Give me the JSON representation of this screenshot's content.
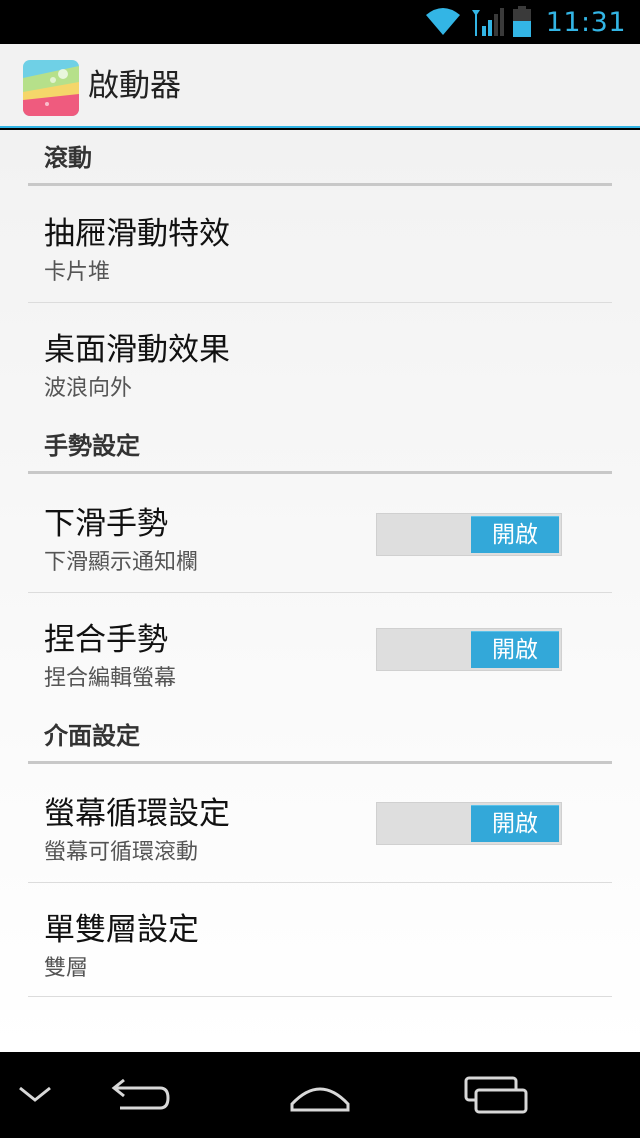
{
  "status_bar": {
    "time": "11:31",
    "icons": [
      "wifi-icon",
      "signal-icon",
      "battery-icon"
    ],
    "accent": "#33b5e5"
  },
  "app": {
    "title": "啟動器",
    "icon": "launcher-app-icon"
  },
  "sections": {
    "scroll": {
      "title": "滾動",
      "drawer_effect": {
        "title": "抽屜滑動特效",
        "summary": "卡片堆"
      },
      "desktop_effect": {
        "title": "桌面滑動效果",
        "summary": "波浪向外"
      }
    },
    "gesture": {
      "title": "手勢設定",
      "swipe_down": {
        "title": "下滑手勢",
        "summary": "下滑顯示通知欄",
        "toggle": "開啟"
      },
      "pinch": {
        "title": "捏合手勢",
        "summary": "捏合編輯螢幕",
        "toggle": "開啟"
      }
    },
    "interface": {
      "title": "介面設定",
      "loop": {
        "title": "螢幕循環設定",
        "summary": "螢幕可循環滾動",
        "toggle": "開啟"
      },
      "layers": {
        "title": "單雙層設定",
        "summary": "雙層"
      }
    }
  },
  "nav_bar": {
    "icons": [
      "hide-keyboard-icon",
      "back-icon",
      "home-icon",
      "recent-apps-icon"
    ]
  },
  "colors": {
    "accent": "#33b5e5",
    "toggle_on": "#33a8d9"
  }
}
